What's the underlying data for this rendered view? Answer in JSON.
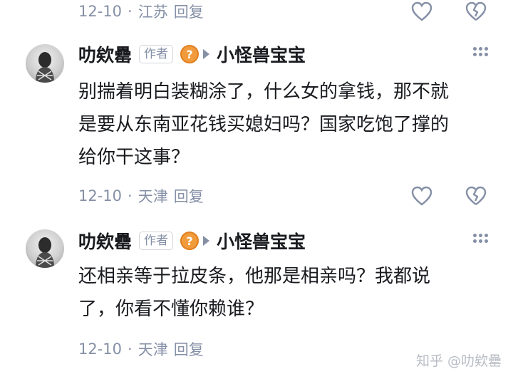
{
  "comments_top": {
    "meta": {
      "date": "12-10",
      "location": "江苏",
      "reply_label": "回复"
    }
  },
  "comments": [
    {
      "author": "叻欸罍",
      "badge": "作者",
      "reply_to": "小怪兽宝宝",
      "text_lines": [
        "别揣着明白装糊涂了，什么女的拿钱，那不就",
        "是要从东南亚花钱买媳妇吗？国家吃饱了撑的",
        "给你干这事？"
      ],
      "meta": {
        "date": "12-10",
        "location": "天津",
        "reply_label": "回复"
      }
    },
    {
      "author": "叻欸罍",
      "badge": "作者",
      "reply_to": "小怪兽宝宝",
      "text_lines": [
        "还相亲等于拉皮条，他那是相亲吗？我都说",
        "了，你看不懂你赖谁？"
      ],
      "meta": {
        "date": "12-10",
        "location": "天津",
        "reply_label": "回复"
      }
    }
  ],
  "watermark": "知乎 @叻欸罍",
  "icons": {
    "like": "heart-icon",
    "dislike": "broken-heart-icon",
    "more": "more-dots-icon",
    "question": "question-badge-icon"
  },
  "colors": {
    "meta": "#8590a6",
    "text": "#191b1f",
    "question_badge": "#f29b3c"
  }
}
